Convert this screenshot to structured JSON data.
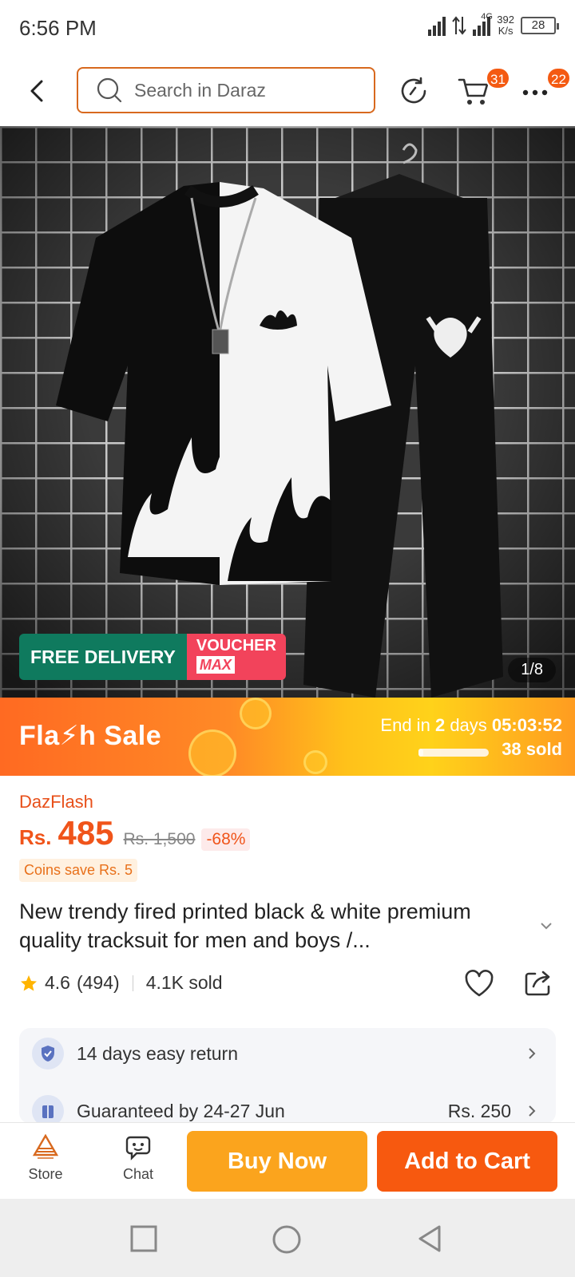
{
  "status_bar": {
    "time": "6:56 PM",
    "network_type": "4G",
    "speed_value": "392",
    "speed_unit": "K/s",
    "battery": "28"
  },
  "header": {
    "search_placeholder": "Search in Daraz",
    "cart_badge": "31",
    "more_badge": "22",
    "icons": [
      "back-icon",
      "search-icon",
      "reload-icon",
      "cart-icon",
      "more-icon"
    ]
  },
  "gallery": {
    "free_delivery": "FREE DELIVERY",
    "voucher_line1": "VOUCHER",
    "voucher_line2": "MAX",
    "counter": "1/8"
  },
  "flash_sale": {
    "title": "Fla⚡h  Sale",
    "end_prefix": "End in",
    "end_days": "2",
    "end_days_unit": "days",
    "end_time": "05:03:52",
    "sold": "38 sold",
    "progress": 0.07
  },
  "product": {
    "brand_tag": "DazFlash",
    "currency": "Rs.",
    "price": "485",
    "old_price": "Rs. 1,500",
    "discount": "-68%",
    "coins_save": "Coins save Rs. 5",
    "title": "New trendy fired printed black & white premium quality tracksuit for men and boys /...",
    "rating": "4.6",
    "reviews": "(494)",
    "sold": "4.1K sold"
  },
  "info": {
    "return_text": "14 days easy return",
    "delivery_text": "Guaranteed by 24-27 Jun",
    "delivery_fee": "Rs. 250"
  },
  "actions": {
    "store_label": "Store",
    "chat_label": "Chat",
    "buy_now": "Buy Now",
    "add_to_cart": "Add to Cart"
  },
  "colors": {
    "accent": "#f7590f",
    "buy_now": "#fba41d",
    "free_delivery": "#0f7a5e",
    "voucher": "#f2435b"
  }
}
